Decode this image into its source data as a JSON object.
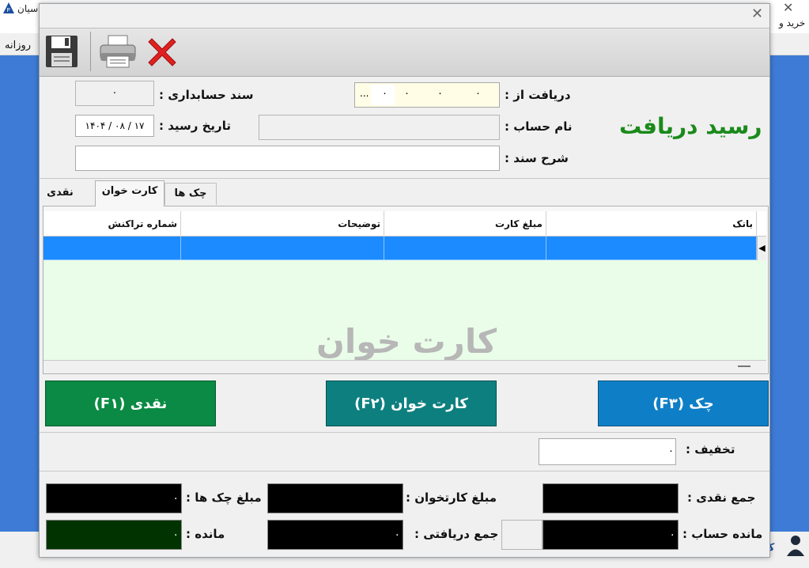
{
  "background_app": {
    "title_fragment": "سیان",
    "buy_fragment": "خرید و",
    "menu_item": "روزانه",
    "status_fragment": "ک"
  },
  "dialog": {
    "form_title": "رسید دریافت",
    "fields": {
      "doc_number_label": "سند حسابداری :",
      "doc_number_value": "۰",
      "received_from_label": "دریافت از :",
      "received_from_value": "...",
      "received_from_digits": [
        "۰",
        "۰",
        "۰",
        "۰"
      ],
      "receipt_date_label": "تاریخ رسید :",
      "receipt_date_value": "۱۴۰۴ / ۰۸ / ۱۷",
      "account_name_label": "نام حساب :",
      "account_name_value": "",
      "description_label": "شرح سند :",
      "description_value": ""
    },
    "tabs": [
      {
        "label": "نقدی",
        "active": false
      },
      {
        "label": "کارت خوان",
        "active": true
      },
      {
        "label": "چک ها",
        "active": false
      }
    ],
    "grid": {
      "columns": [
        "بانک",
        "مبلغ کارت",
        "توضیحات",
        "شماره تراکنش"
      ],
      "watermark": "کارت  خوان"
    },
    "buttons": {
      "cash": "نقدی (F۱)",
      "card": "کارت خوان (F۲)",
      "check": "چک (F۳)"
    },
    "discount": {
      "label": "تخفیف :",
      "value": "۰"
    },
    "totals": {
      "cash_total_label": "جمع نقدی :",
      "card_total_label": "مبلغ کارتخوان :",
      "checks_total_label": "مبلغ چک ها :",
      "checks_total_value": "۰",
      "account_balance_label": "مانده حساب :",
      "account_balance_value": "۰",
      "received_total_label": "جمع  دریافتی :",
      "received_total_value": "۰",
      "remaining_label": "مانده :",
      "remaining_value": "۰"
    },
    "colors": {
      "title_green": "#1a8a1a",
      "cash_button": "#0a8a44",
      "card_button": "#0e7f7f",
      "check_button": "#0e7fc6",
      "selected_row": "#1b8bff",
      "grid_bg": "#e9fde9",
      "remaining_box": "#003300"
    },
    "icons": [
      "save-icon",
      "print-icon",
      "cancel-icon",
      "close-icon"
    ]
  }
}
